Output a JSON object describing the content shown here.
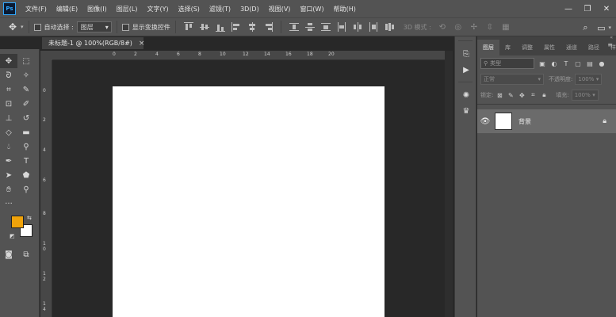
{
  "app": {
    "logo": "Ps",
    "menu": [
      "文件(F)",
      "编辑(E)",
      "图像(I)",
      "图层(L)",
      "文字(Y)",
      "选择(S)",
      "滤镜(T)",
      "3D(D)",
      "视图(V)",
      "窗口(W)",
      "帮助(H)"
    ],
    "window_controls": {
      "minimize": "—",
      "restore": "❐",
      "close": "✕"
    }
  },
  "options_bar": {
    "auto_select_label": "自动选择 :",
    "auto_select_value": "图层",
    "show_transform_label": "显示变换控件",
    "mode_3d_label": "3D 模式 :",
    "icons": [
      "move-tool-icon",
      "align-icons",
      "3d-mode-icons",
      "search-icon",
      "workspace-icon"
    ]
  },
  "document": {
    "tab_title": "未标题-1 @ 100%(RGB/8#)",
    "tab_close": "×",
    "ruler_h_labels": [
      "0",
      "2",
      "4",
      "6",
      "8",
      "10",
      "12",
      "14",
      "16",
      "18",
      "20"
    ],
    "ruler_v_labels": [
      "0",
      "2",
      "4",
      "6",
      "8",
      "1\n0",
      "1\n2",
      "1\n4",
      "1\n6"
    ]
  },
  "colors": {
    "foreground": "#f0a30a",
    "background": "#ffffff",
    "ui_panel": "#535353",
    "workspace": "#282828"
  },
  "layers_panel": {
    "tabs": [
      "图层",
      "库",
      "调整",
      "属性",
      "通道",
      "路径",
      "样式"
    ],
    "active_tab": "图层",
    "search_placeholder": "类型",
    "blend_mode": "正常",
    "opacity_label": "不透明度:",
    "opacity_value": "100%",
    "lock_label": "锁定:",
    "fill_label": "填充:",
    "fill_value": "100%",
    "layer": {
      "name": "背景",
      "visible": true,
      "locked": true
    }
  }
}
